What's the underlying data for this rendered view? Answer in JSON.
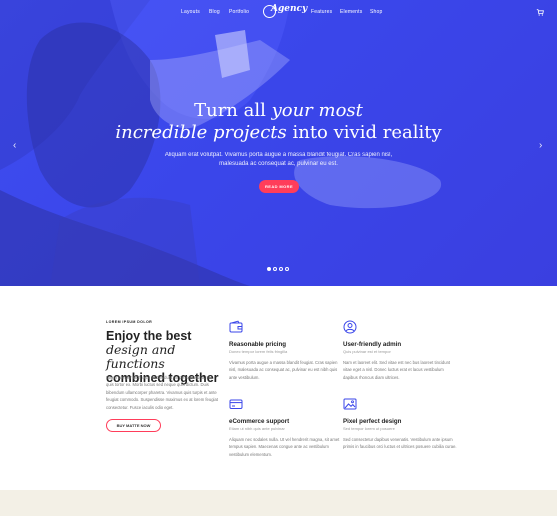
{
  "nav": {
    "items": [
      "Layouts",
      "Blog",
      "Portfolio",
      "Features",
      "Elements",
      "Shop"
    ],
    "logo": "Agency"
  },
  "hero": {
    "title_line1_plain": "Turn all ",
    "title_line1_em": "your most",
    "title_line2_em": "incredible projects",
    "title_line2_plain": " into vivid reality",
    "subtitle": "Aliquam erat volutpat. Vivamus porta augue a massa blandit feugiat. Cras sapien nisl, malesuada ac consequat ac, pulvinar eu est.",
    "button": "READ MORE"
  },
  "intro": {
    "eyebrow": "LOREM IPSUM DOLOR",
    "heading_line1": "Enjoy the best",
    "heading_line2_em": "design and functions",
    "heading_line3": "combined together",
    "text": "Etiam semper nibh orci, ac tincidunt mi consectetur a. In quis tortor ex. Morbi luctus sed neque quis dictum. Duis bibendum ullamcorper pharetra. Vivamus quis turpis et ante feugiat commodo. Suspendisse maximus ex at lorem feugiat consectetur. Fusce iaculis odio eget.",
    "button": "BUY MATTE NOW"
  },
  "features": [
    {
      "title": "Reasonable pricing",
      "subtitle": "Donec tempor lorem felis fringilla",
      "text": "Vivamus porta augue a massa blandit feugiat. Cras sapien nisl, malesuada ac consequat ac, pulvinar eu est nibh quis ante vestibulum.",
      "icon": "wallet-icon"
    },
    {
      "title": "User-friendly admin",
      "subtitle": "Quis pulvinar est et tempor",
      "text": "Nam et laoreet elit. Sed vitae est nec bus laoreet tincidunt vitae eget a nisl. Donec luctus erat et lacus vestibulum dapibus rhoncus diam ultrices.",
      "icon": "user-icon"
    },
    {
      "title": "eCommerce support",
      "subtitle": "Etiam ut nibh quis ante pulvinar",
      "text": "Aliquam nec sodales nulla. Ut vel hendrerit magna, sit amet tempus sapien. Maecenas congue ante ac vestibulum vestibulum elementum.",
      "icon": "credit-card-icon"
    },
    {
      "title": "Pixel perfect design",
      "subtitle": "Sed tempor lorem ut posuere",
      "text": "Sed consectetur dapibus venenatis. Vestibulum ante ipsum primis in faucibus orci luctus et ultrices posuere cubilia curae.",
      "icon": "image-icon"
    }
  ]
}
